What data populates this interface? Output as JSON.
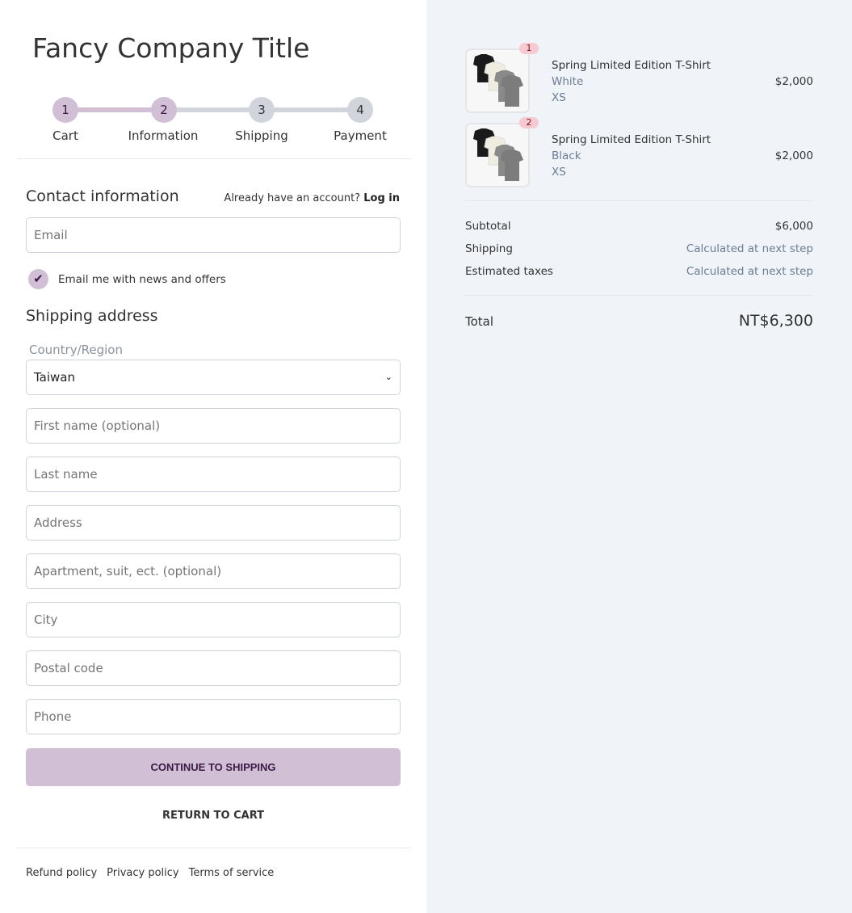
{
  "header": {
    "title": "Fancy Company Title"
  },
  "steps": [
    {
      "num": "1",
      "label": "Cart"
    },
    {
      "num": "2",
      "label": "Information"
    },
    {
      "num": "3",
      "label": "Shipping"
    },
    {
      "num": "4",
      "label": "Payment"
    }
  ],
  "contact": {
    "heading": "Contact information",
    "account_prompt": "Already have an account?",
    "login": "Log in",
    "email_placeholder": "Email",
    "newsletter_label": "Email me with news and offers",
    "newsletter_checked": true
  },
  "shipping": {
    "heading": "Shipping address",
    "country_label": "Country/Region",
    "country_value": "Taiwan",
    "fields": [
      "First name (optional)",
      "Last name",
      "Address",
      "Apartment, suit, ect. (optional)",
      "City",
      "Postal code",
      "Phone"
    ]
  },
  "actions": {
    "continue": "CONTINUE TO SHIPPING",
    "return": "RETURN TO CART"
  },
  "footer": {
    "links": [
      "Refund policy",
      "Privacy policy",
      "Terms of service"
    ]
  },
  "cart": {
    "items": [
      {
        "qty": "1",
        "name": "Spring Limited Edition T-Shirt",
        "color": "White",
        "size": "XS",
        "price": "$2,000"
      },
      {
        "qty": "2",
        "name": "Spring Limited Edition T-Shirt",
        "color": "Black",
        "size": "XS",
        "price": "$2,000"
      }
    ],
    "summary": {
      "subtotal_label": "Subtotal",
      "subtotal": "$6,000",
      "shipping_label": "Shipping",
      "shipping": "Calculated at next step",
      "taxes_label": "Estimated taxes",
      "taxes": "Calculated at next step",
      "total_label": "Total",
      "total": "NT$6,300"
    }
  },
  "colors": {
    "accent": "#d1bfd6",
    "accent_text": "#3b1a46",
    "panel": "#f0f3f8"
  }
}
